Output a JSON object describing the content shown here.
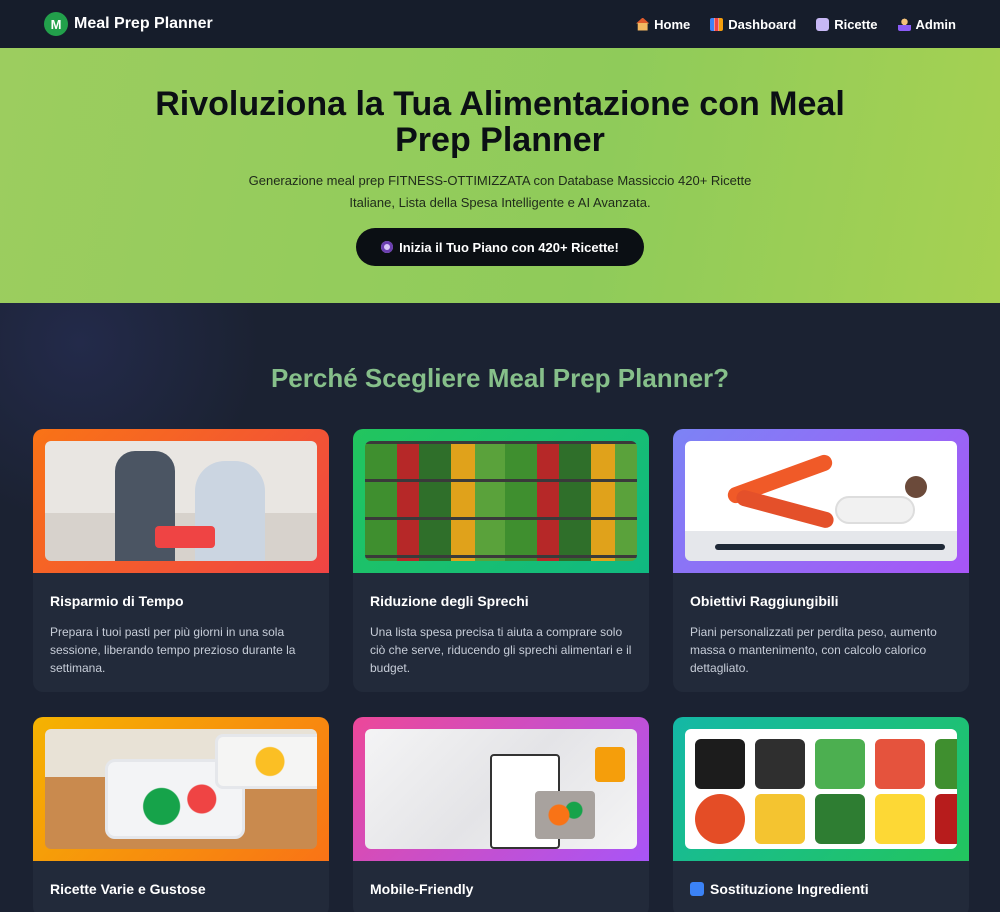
{
  "nav": {
    "brand_mark": "M",
    "brand": "Meal Prep Planner",
    "links": [
      {
        "label": "Home",
        "icon": "home-icon"
      },
      {
        "label": "Dashboard",
        "icon": "chart-icon"
      },
      {
        "label": "Ricette",
        "icon": "recipe-icon"
      },
      {
        "label": "Admin",
        "icon": "admin-icon"
      }
    ]
  },
  "hero": {
    "title": "Rivoluziona la Tua Alimentazione con Meal Prep Planner",
    "subtitle": "Generazione meal prep FITNESS-OTTIMIZZATA con Database Massiccio 420+ Ricette Italiane, Lista della Spesa Intelligente e AI Avanzata.",
    "cta_label": "Inizia il Tuo Piano con 420+ Ricette!"
  },
  "features": {
    "heading": "Perché Scegliere Meal Prep Planner?",
    "cards": [
      {
        "title": "Risparmio di Tempo",
        "desc": "Prepara i tuoi pasti per più giorni in una sola sessione, liberando tempo prezioso durante la settimana."
      },
      {
        "title": "Riduzione degli Sprechi",
        "desc": "Una lista spesa precisa ti aiuta a comprare solo ciò che serve, riducendo gli sprechi alimentari e il budget."
      },
      {
        "title": "Obiettivi Raggiungibili",
        "desc": "Piani personalizzati per perdita peso, aumento massa o mantenimento, con calcolo calorico dettagliato."
      },
      {
        "title": "Ricette Varie e Gustose",
        "desc": ""
      },
      {
        "title": "Mobile-Friendly",
        "desc": ""
      },
      {
        "title": "Sostituzione Ingredienti",
        "desc": ""
      }
    ]
  },
  "colors": {
    "hero_green": "#9ccd5f",
    "heading_green": "#86bf8a",
    "background": "#1b2232",
    "brand_green": "#22a04b"
  }
}
